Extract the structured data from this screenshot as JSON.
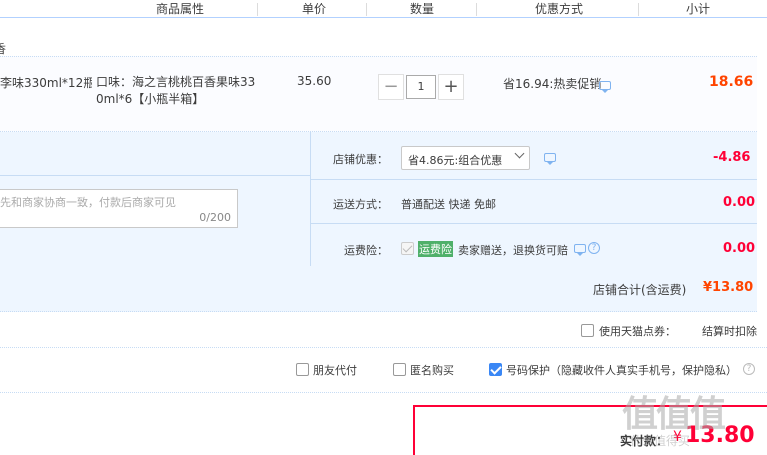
{
  "header": {
    "columns": [
      "商品属性",
      "单价",
      "数量",
      "优惠方式",
      "小计"
    ]
  },
  "shop_name_fragment": "香",
  "item": {
    "title_fragment": "李味330ml*12瓶...",
    "attributes": "口味：海之言桃桃百香果味330ml*6【小瓶半箱】",
    "price": "35.60",
    "quantity": "1",
    "discount": "省16.94:热卖促销",
    "subtotal": "18.66"
  },
  "shop_options": {
    "coupon_label": "店铺优惠：",
    "coupon_selected": "省4.86元:组合优惠",
    "coupon_amount": "-4.86",
    "shipping_label": "运送方式：",
    "shipping_value": "普通配送 快递 免邮",
    "shipping_amount": "0.00",
    "insurance_label": "运费险：",
    "insurance_badge": "运费险",
    "insurance_value": "卖家赠送，退换货可赔",
    "insurance_amount": "0.00",
    "memo_placeholder": "先和商家协商一致，付款后商家可见",
    "memo_counter": "0/200"
  },
  "shop_total": {
    "label": "店铺合计(含运费)",
    "amount": "¥13.80"
  },
  "tmall_points": {
    "label": "使用天猫点券：",
    "value": "结算时扣除"
  },
  "extra_options": {
    "friend_pay": "朋友代付",
    "anonymous": "匿名购买",
    "privacy": "号码保护（隐藏收件人真实手机号，保护隐私）"
  },
  "pay": {
    "label": "实付款：",
    "currency": "¥",
    "amount": "13.80"
  },
  "watermark": {
    "logo": "值值值",
    "text": "什么值得买"
  },
  "colors": {
    "accent_red": "#ff0036",
    "total_orange": "#ff4400",
    "link_blue": "#3a87f5",
    "badge_green": "#4fb06a"
  }
}
